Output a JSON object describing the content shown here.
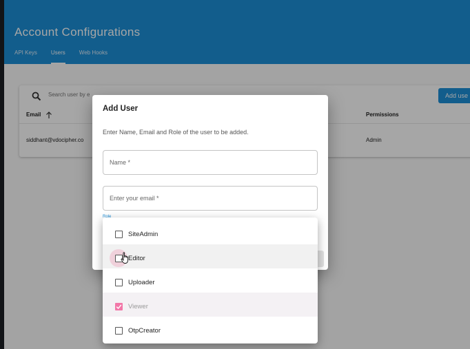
{
  "header": {
    "title": "Account Configurations"
  },
  "tabs": [
    {
      "label": "API Keys",
      "active": false
    },
    {
      "label": "Users",
      "active": true
    },
    {
      "label": "Web Hooks",
      "active": false
    }
  ],
  "users_table": {
    "search_placeholder": "Search user by e",
    "add_user_label": "Add use",
    "columns": {
      "email": "Email",
      "permissions": "Permissions"
    },
    "rows": [
      {
        "email": "siddhant@vdocipher.co",
        "permissions": "Admin"
      }
    ]
  },
  "dialog": {
    "title": "Add User",
    "description": "Enter Name, Email and Role of the user to be added.",
    "name_placeholder": "Name *",
    "email_placeholder": "Enter your email *",
    "role_label": "Role"
  },
  "role_options": [
    {
      "label": "SiteAdmin",
      "checked": false
    },
    {
      "label": "Editor",
      "checked": false,
      "hovered": true
    },
    {
      "label": "Uploader",
      "checked": false
    },
    {
      "label": "Viewer",
      "checked": true
    },
    {
      "label": "OtpCreator",
      "checked": false
    }
  ],
  "colors": {
    "brand": "#1c8fd8",
    "checkbox_checked": "#f277a8"
  },
  "icons": [
    "search-icon",
    "arrow-up-icon",
    "check-icon",
    "hand-cursor-icon"
  ]
}
